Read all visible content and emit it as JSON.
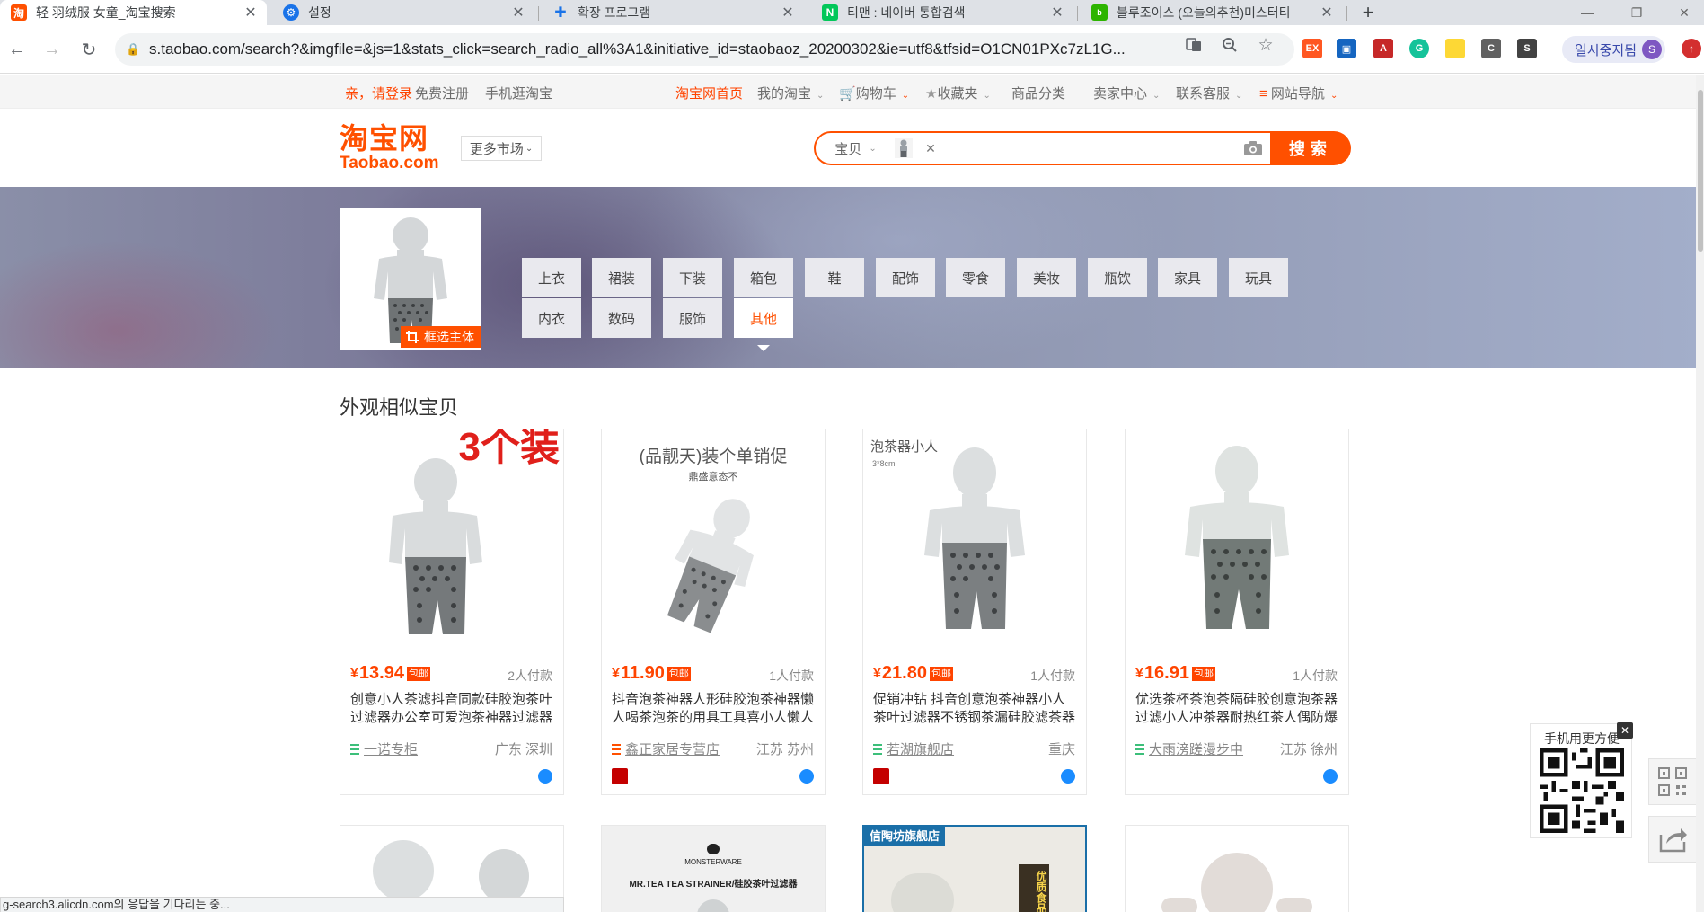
{
  "browser": {
    "tabs": [
      {
        "title": "轻 羽绒服 女童_淘宝搜索",
        "icon": "taobao-icon",
        "active": true
      },
      {
        "title": "설정",
        "icon": "gear-icon",
        "active": false
      },
      {
        "title": "확장 프로그램",
        "icon": "puzzle-icon",
        "active": false
      },
      {
        "title": "티맨 : 네이버 통합검색",
        "icon": "naver-icon",
        "active": false
      },
      {
        "title": "블루조이스 (오늘의추천)미스터티",
        "icon": "blog-icon",
        "active": false
      }
    ],
    "new_tab_symbol": "+",
    "url": "s.taobao.com/search?&imgfile=&js=1&stats_click=search_radio_all%3A1&initiative_id=staobaoz_20200302&ie=utf8&tfsid=O1CN01PXc7zL1G...",
    "profile_status": "일시중지됨",
    "profile_initial": "S",
    "status_text": "g-search3.alicdn.com의 응답을 기다리는 중..."
  },
  "site_nav": {
    "login": "亲，请登录",
    "register": "免费注册",
    "mobile": "手机逛淘宝",
    "home": "淘宝网首页",
    "my_taobao": "我的淘宝",
    "cart": "购物车",
    "favorites": "收藏夹",
    "categories": "商品分类",
    "seller": "卖家中心",
    "service": "联系客服",
    "site_map": "网站导航"
  },
  "header": {
    "logo_cn": "淘宝网",
    "logo_en": "Taobao.com",
    "more_markets": "更多市场",
    "search_type": "宝贝",
    "search_button": "搜索",
    "accent": "#ff5000"
  },
  "filter": {
    "crop_label": "框选主体",
    "categories": [
      [
        "上衣",
        "内衣"
      ],
      [
        "裙装",
        "数码"
      ],
      [
        "下装",
        "服饰"
      ],
      [
        "箱包",
        "其他"
      ],
      [
        "鞋"
      ],
      [
        "配饰"
      ],
      [
        "零食"
      ],
      [
        "美妆"
      ],
      [
        "瓶饮"
      ],
      [
        "家具"
      ],
      [
        "玩具"
      ]
    ],
    "selected": "其他"
  },
  "results": {
    "section_title": "外观相似宝贝",
    "items": [
      {
        "price": "13.94",
        "currency": "¥",
        "ship_badge": "包邮",
        "paid": "2人付款",
        "desc": "创意小人茶滤抖音同款硅胶泡茶叶过滤器办公室可爱泡茶神器过滤器",
        "shop": "一诺专柜",
        "location": "广东 深圳",
        "tmall": false,
        "overlay": "3个装"
      },
      {
        "price": "11.90",
        "currency": "¥",
        "ship_badge": "包邮",
        "paid": "1人付款",
        "desc": "抖音泡茶神器人形硅胶泡茶神器懒人喝茶泡茶的用具工具喜小人懒人",
        "shop": "鑫正家居专营店",
        "location": "江苏 苏州",
        "tmall": true,
        "overlay": "(品靓天)装个单销促",
        "overlay_sub": "鼎盛意态不"
      },
      {
        "price": "21.80",
        "currency": "¥",
        "ship_badge": "包邮",
        "paid": "1人付款",
        "desc": "促销冲钻 抖音创意泡茶神器小人茶叶过滤器不锈钢茶漏硅胶滤茶器",
        "shop": "若湖旗舰店",
        "location": "重庆",
        "tmall": true,
        "overlay": "泡茶器小人",
        "overlay_sub": "3*8cm"
      },
      {
        "price": "16.91",
        "currency": "¥",
        "ship_badge": "包邮",
        "paid": "1人付款",
        "desc": "优选茶杯茶泡茶隔硅胶创意泡茶器过滤小人冲茶器耐热红茶人偶防爆",
        "shop": "大雨滂蹉漫步中",
        "location": "江苏 徐州",
        "tmall": false,
        "overlay": ""
      }
    ],
    "row2_overlays": [
      {
        "brand": "MONSTERWARE",
        "text": "MR.TEA TEA STRAINER/硅胶茶叶过滤器"
      },
      {
        "badge": "信陶坊旗舰店",
        "side": "优质食品"
      }
    ]
  },
  "qr": {
    "title": "手机用更方便",
    "close": "✕"
  }
}
